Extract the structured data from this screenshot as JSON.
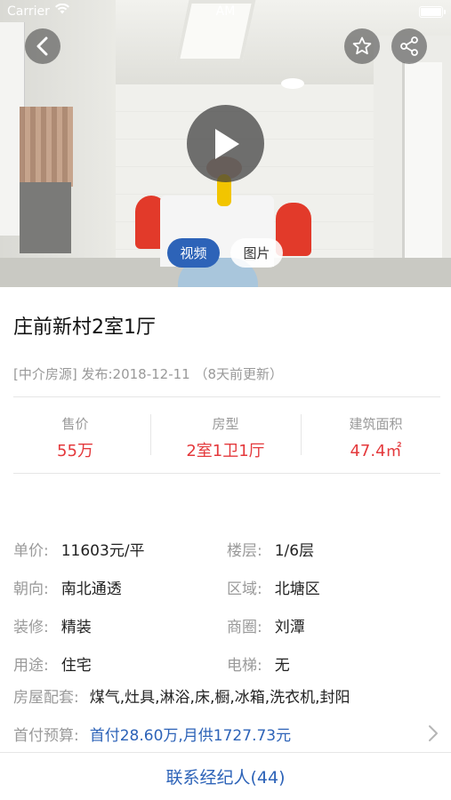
{
  "status_bar": {
    "carrier": "Carrier",
    "time": "AM"
  },
  "media": {
    "tabs": [
      {
        "label": "视频"
      },
      {
        "label": "图片"
      }
    ]
  },
  "listing": {
    "title": "庄前新村2室1厅",
    "meta": "[中介房源] 发布:2018-12-11 （8天前更新）"
  },
  "stats": [
    {
      "label": "售价",
      "value": "55万"
    },
    {
      "label": "房型",
      "value": "2室1卫1厅"
    },
    {
      "label": "建筑面积",
      "value": "47.4㎡"
    }
  ],
  "details": [
    [
      {
        "key": "单价:",
        "value": "11603元/平"
      },
      {
        "key": "楼层:",
        "value": "1/6层"
      }
    ],
    [
      {
        "key": "朝向:",
        "value": "南北通透"
      },
      {
        "key": "区域:",
        "value": "北塘区"
      }
    ],
    [
      {
        "key": "装修:",
        "value": "精装"
      },
      {
        "key": "商圈:",
        "value": "刘潭"
      }
    ],
    [
      {
        "key": "用途:",
        "value": "住宅"
      },
      {
        "key": "电梯:",
        "value": "无"
      }
    ]
  ],
  "facilities": {
    "key": "房屋配套:",
    "value": "煤气,灶具,淋浴,床,橱,冰箱,洗衣机,封阳"
  },
  "budget": {
    "key": "首付预算:",
    "value": "首付28.60万,月供1727.73元"
  },
  "contact": {
    "label": "联系经纪人(44)"
  },
  "colors": {
    "accent_blue": "#2d63b8",
    "price_red": "#e4393c",
    "label_gray": "#9a9a9a"
  },
  "icons": {
    "back": "chevron-left-icon",
    "favorite": "star-icon",
    "share": "share-icon",
    "play": "play-icon",
    "more": "chevron-right-icon",
    "wifi": "wifi-icon",
    "battery": "battery-icon"
  }
}
